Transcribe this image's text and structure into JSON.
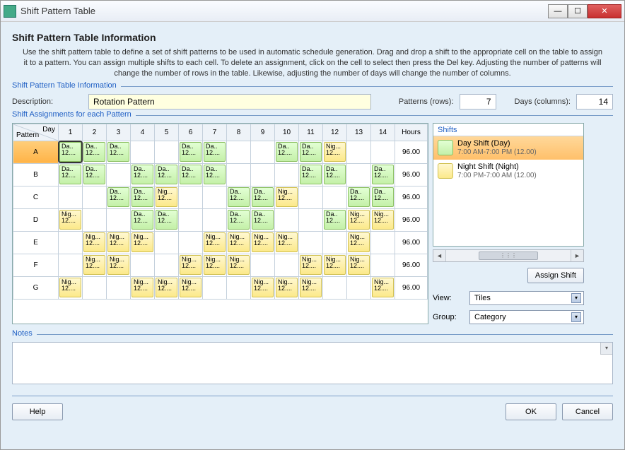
{
  "window": {
    "title": "Shift Pattern Table"
  },
  "header": {
    "title": "Shift Pattern Table Information",
    "description": "Use the shift pattern table to define a set of shift patterns to be used in automatic schedule generation. Drag and drop a shift to the appropriate cell on the table to assign it to a pattern. You can assign multiple shifts to each cell. To delete an assignment, click on the cell to select then press the Del key.  Adjusting the number of patterns will change the number of rows in the table. Likewise, adjusting the number of days will change the number of columns."
  },
  "info": {
    "legend": "Shift Pattern Table Information",
    "description_label": "Description:",
    "description_value": "Rotation Pattern",
    "patterns_label": "Patterns (rows):",
    "patterns_value": "7",
    "days_label": "Days (columns):",
    "days_value": "14"
  },
  "assignments": {
    "legend": "Shift Assignments for each Pattern",
    "corner_day": "Day",
    "corner_pattern": "Pattern",
    "days": [
      "1",
      "2",
      "3",
      "4",
      "5",
      "6",
      "7",
      "8",
      "9",
      "10",
      "11",
      "12",
      "13",
      "14"
    ],
    "hours_header": "Hours",
    "hours": [
      "96.00",
      "96.00",
      "96.00",
      "96.00",
      "96.00",
      "96.00",
      "96.00"
    ],
    "row_labels": [
      "A",
      "B",
      "C",
      "D",
      "E",
      "F",
      "G"
    ],
    "chip_day_l1": "Da..",
    "chip_day_l2": "12....",
    "chip_night_l1": "Nig...",
    "chip_night_l2": "12....",
    "grid": [
      [
        "D",
        "D",
        "D",
        "",
        "",
        "D",
        "D",
        "",
        "",
        "D",
        "D",
        "N",
        "",
        ""
      ],
      [
        "D",
        "D",
        "",
        "D",
        "D",
        "D",
        "D",
        "",
        "",
        "",
        "D",
        "D",
        "",
        "D"
      ],
      [
        "",
        "",
        "D",
        "D",
        "N",
        "",
        "",
        "D",
        "D",
        "N",
        "",
        "",
        "D",
        "D"
      ],
      [
        "N",
        "",
        "",
        "D",
        "D",
        "",
        "",
        "D",
        "D",
        "",
        "",
        "D",
        "N",
        "N"
      ],
      [
        "",
        "N",
        "N",
        "N",
        "",
        "",
        "N",
        "N",
        "N",
        "N",
        "",
        "",
        "N",
        ""
      ],
      [
        "",
        "N",
        "N",
        "",
        "",
        "N",
        "N",
        "N",
        "",
        "",
        "N",
        "N",
        "N",
        ""
      ],
      [
        "N",
        "",
        "",
        "N",
        "N",
        "N",
        "",
        "",
        "N",
        "N",
        "N",
        "",
        "",
        "N"
      ]
    ]
  },
  "shifts": {
    "legend": "Shifts",
    "items": [
      {
        "name": "Day Shift (Day)",
        "detail": "7:00 AM-7:00 PM (12.00)"
      },
      {
        "name": "Night Shift (Night)",
        "detail": "7:00 PM-7:00 AM (12.00)"
      }
    ],
    "assign_label": "Assign Shift",
    "view_label": "View:",
    "view_value": "Tiles",
    "group_label": "Group:",
    "group_value": "Category"
  },
  "notes": {
    "legend": "Notes"
  },
  "buttons": {
    "help": "Help",
    "ok": "OK",
    "cancel": "Cancel"
  }
}
